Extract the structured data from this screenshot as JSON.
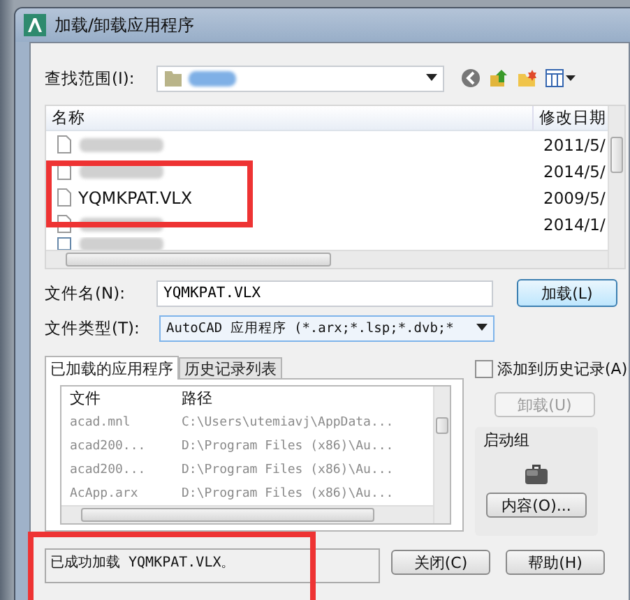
{
  "window": {
    "title": "加载/卸载应用程序"
  },
  "look_in": {
    "label": "查找范围(I):"
  },
  "file_list": {
    "columns": [
      "名称",
      "修改日期"
    ],
    "rows": [
      {
        "name_blurred": true,
        "date": "2011/5/",
        "highlighted": false
      },
      {
        "name_blurred": true,
        "date": "2014/5/",
        "highlighted": false
      },
      {
        "name": "YQMKPAT.VLX",
        "date": "2009/5/",
        "highlighted": true
      },
      {
        "name_blurred": true,
        "date": "2014/1/",
        "highlighted": false
      }
    ]
  },
  "file_name": {
    "label": "文件名(N):",
    "value": "YQMKPAT.VLX"
  },
  "file_type": {
    "label": "文件类型(T):",
    "value": "AutoCAD 应用程序 (*.arx;*.lsp;*.dvb;*"
  },
  "load_button": "加载(L)",
  "tabs": [
    {
      "label": "已加载的应用程序",
      "selected": true
    },
    {
      "label": "历史记录列表",
      "selected": false
    }
  ],
  "loaded_list": {
    "columns": [
      "文件",
      "路径"
    ],
    "rows": [
      {
        "file": "acad.mnl",
        "path": "C:\\Users\\utemiavj\\AppData..."
      },
      {
        "file": "acad200...",
        "path": "D:\\Program Files (x86)\\Au..."
      },
      {
        "file": "acad200...",
        "path": "D:\\Program Files (x86)\\Au..."
      },
      {
        "file": "AcApp.arx",
        "path": "D:\\Program Files (x86)\\Au..."
      }
    ]
  },
  "add_to_history": {
    "label": "添加到历史记录(A)",
    "checked": false
  },
  "unload_button": {
    "label": "卸载(U)",
    "disabled": true
  },
  "startup_suite": {
    "title": "启动组",
    "button": "内容(O)..."
  },
  "status": {
    "text": "已成功加载 YQMKPAT.VLX。",
    "highlighted": true
  },
  "buttons": [
    "关闭(C)",
    "帮助(H)"
  ]
}
